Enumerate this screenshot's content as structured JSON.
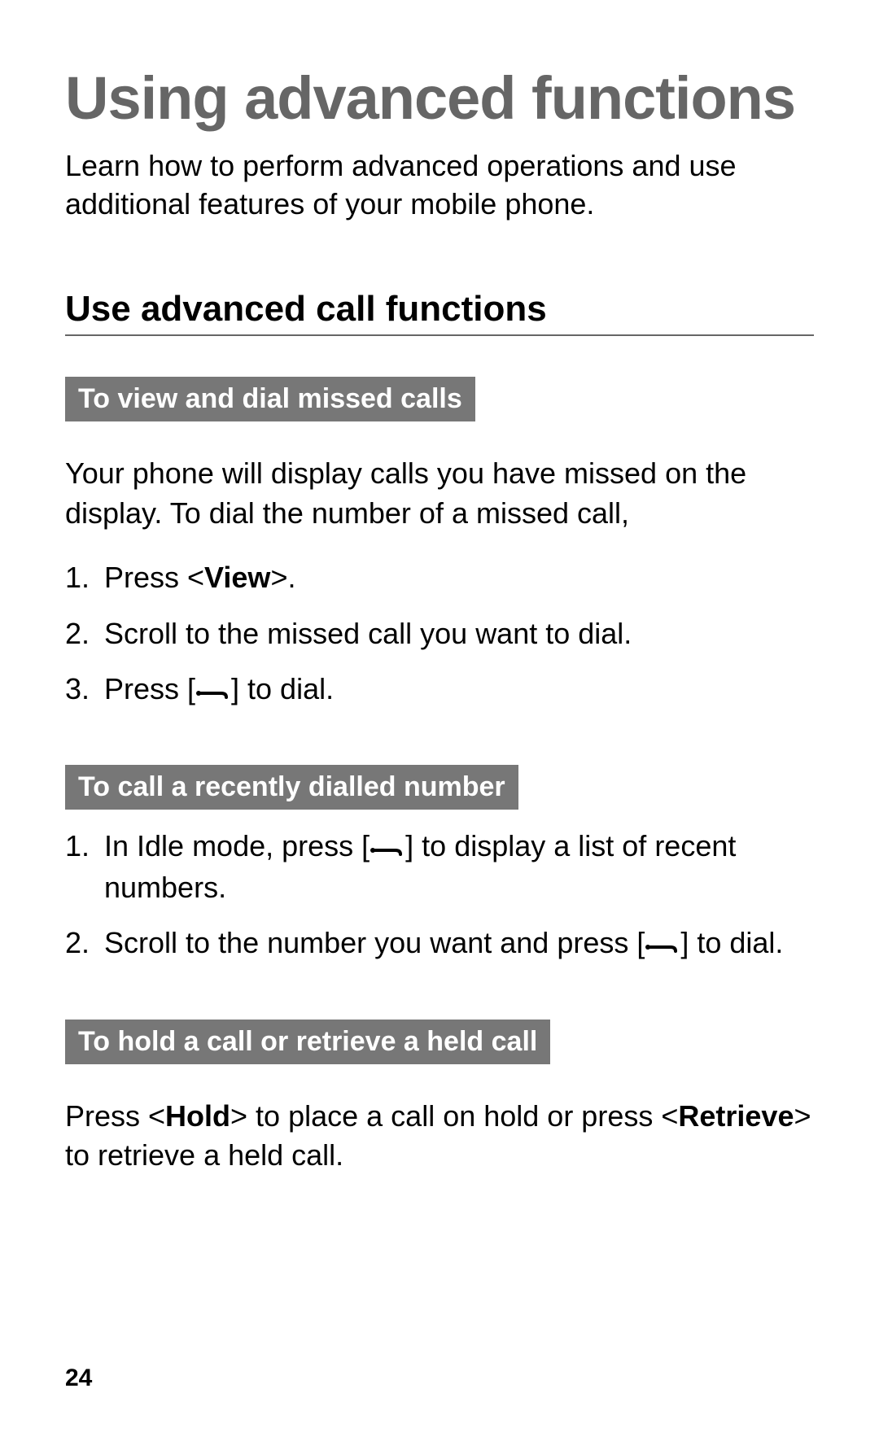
{
  "title": "Using advanced functions",
  "intro": "Learn how to perform advanced operations and use additional features of your mobile phone.",
  "section_heading": "Use advanced call functions",
  "sub1": {
    "label": "To view and dial missed calls",
    "desc": "Your phone will display calls you have missed on the display. To dial the number of a missed call,",
    "steps": {
      "s1_pre": "Press <",
      "s1_key": "View",
      "s1_post": ">.",
      "s2": "Scroll to the missed call you want to dial.",
      "s3_pre": "Press [",
      "s3_post": "] to dial."
    }
  },
  "sub2": {
    "label": "To call a recently dialled number",
    "steps": {
      "s1_pre": "In Idle mode, press [",
      "s1_post": "] to display a list of recent numbers.",
      "s2_pre": "Scroll to the number you want and press [",
      "s2_post": "] to dial."
    }
  },
  "sub3": {
    "label": "To hold a call or retrieve a held call",
    "body": {
      "pre": "Press <",
      "key1": "Hold",
      "mid": "> to place a call on hold or press <",
      "key2": "Retrieve",
      "post": "> to retrieve a held call."
    }
  },
  "page_number": "24"
}
